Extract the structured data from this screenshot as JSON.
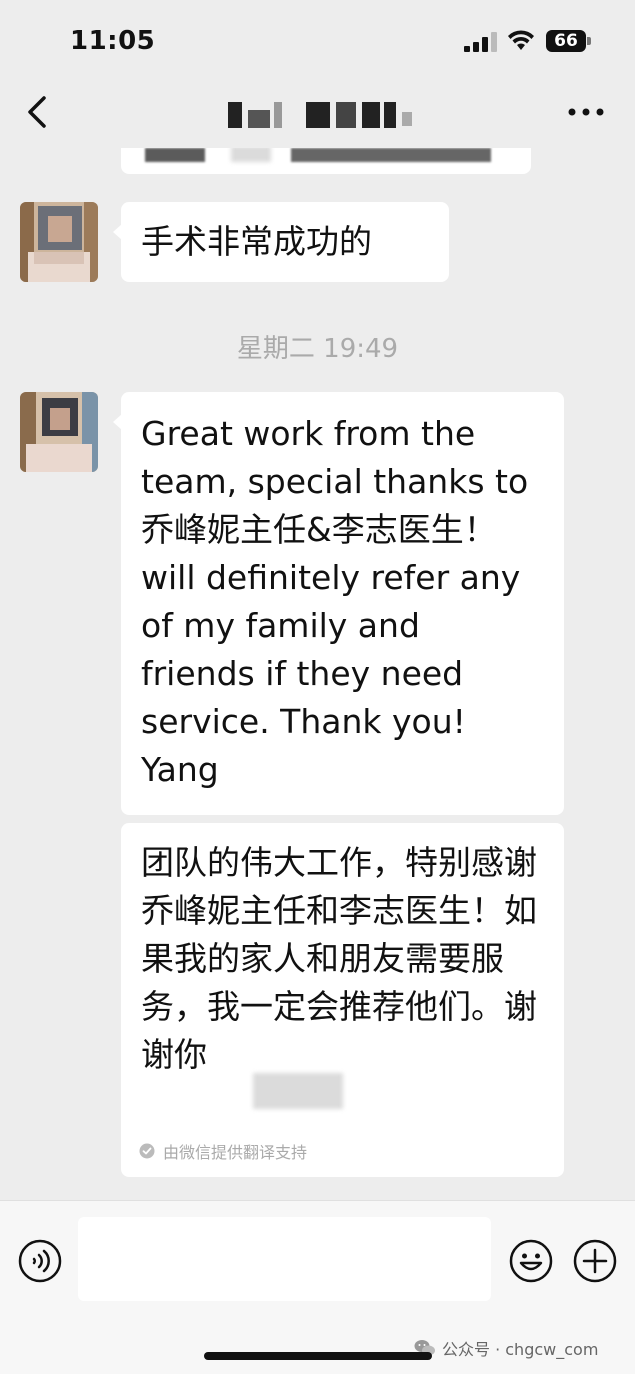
{
  "status_bar": {
    "time": "11:05",
    "battery": "66"
  },
  "messages": [
    {
      "id": "msg-1",
      "text": "手术非常成功的"
    },
    {
      "id": "msg-2",
      "text": "Great work from the team, special thanks to 乔峰妮主任&李志医生！ will definitely refer any of my family and friends if they need service. Thank you! Yang"
    }
  ],
  "timestamp": "星期二 19:49",
  "translation": {
    "text": "团队的伟大工作，特别感谢乔峰妮主任和李志医生！如果我的家人和朋友需要服务，我一定会推荐他们。谢谢你",
    "note": "由微信提供翻译支持"
  },
  "watermark": "公众号 · chgcw_com",
  "icons": {
    "back": "chevron-left-icon",
    "more": "more-dots-icon",
    "voice": "voice-input-icon",
    "emoji": "emoji-icon",
    "plus": "plus-icon",
    "check": "check-circle-icon",
    "wechat": "wechat-logo-icon"
  }
}
